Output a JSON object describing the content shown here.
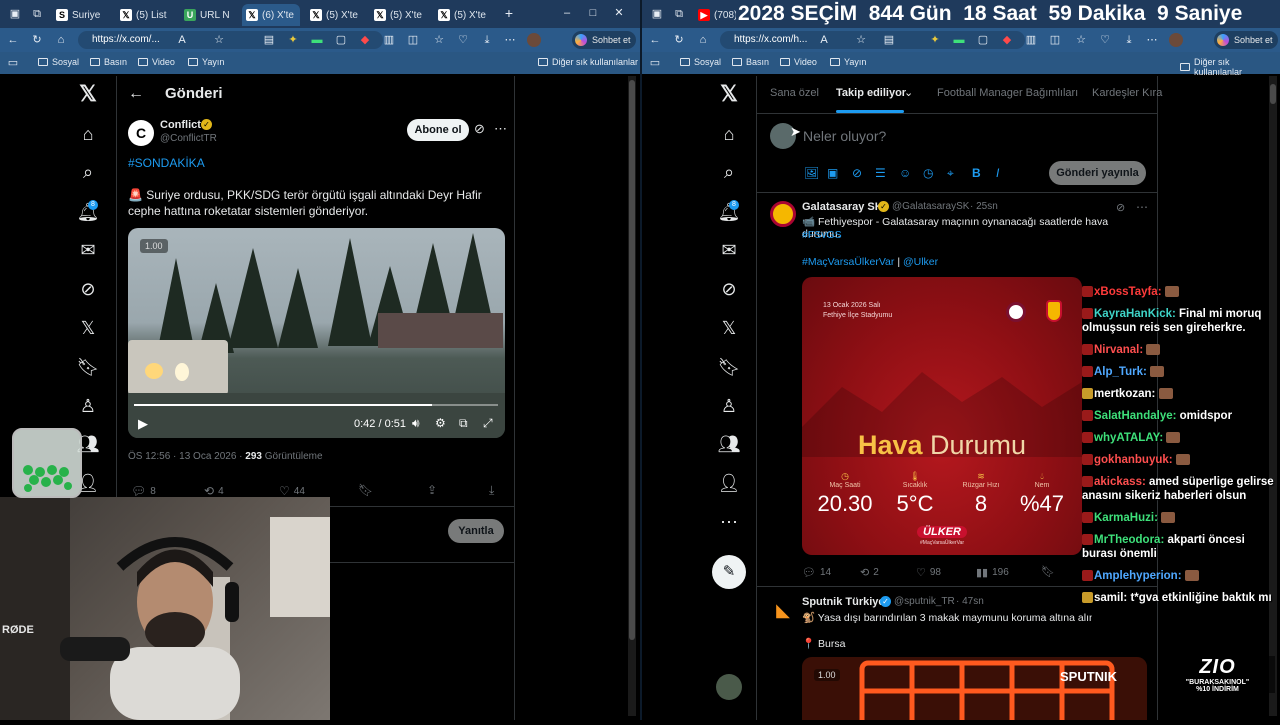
{
  "left_browser": {
    "tabs": [
      {
        "title": "Suriye",
        "icon": "S"
      },
      {
        "title": "(5) List",
        "icon": "X"
      },
      {
        "title": "URL N",
        "icon": "U"
      },
      {
        "title": "(6) X'te",
        "icon": "X"
      },
      {
        "title": "(5) X'te",
        "icon": "X"
      },
      {
        "title": "(5) X'te",
        "icon": "X"
      },
      {
        "title": "(5) X'te",
        "icon": "X"
      }
    ],
    "url": "https://x.com/...",
    "copilot_label": "Sohbet et",
    "bookmarks": [
      "Sosyal",
      "Basın",
      "Video",
      "Yayın"
    ],
    "other_bookmarks": "Diğer sık kullanılanlar"
  },
  "right_browser": {
    "tab_count": "(708)",
    "countdown": "2028 SEÇİM  844 Gün  18 Saat  59 Dakika  9 Saniye",
    "url": "https://x.com/h...",
    "copilot_label": "Sohbet et",
    "bookmarks": [
      "Sosyal",
      "Basın",
      "Video",
      "Yayın"
    ],
    "other_bookmarks": "Diğer sık kullanılanlar"
  },
  "post_page": {
    "header": "Gönderi",
    "author_name": "Conflict",
    "author_handle": "@ConflictTR",
    "follow_label": "Abone ol",
    "hashtag": "#SONDAKİKA",
    "text": "🚨 Suriye ordusu, PKK/SDG terör örgütü işgali altındaki Deyr Hafir cephe hattına roketatar sistemleri gönderiyor.",
    "video_speed": "1.00",
    "video_time": "0:42 / 0:51",
    "video_progress": 0.82,
    "meta_time": "ÖS 12:56 · 13 Oca 2026 ·",
    "views_count": "293",
    "views_label": "Görüntüleme",
    "replies": "8",
    "reposts": "4",
    "likes": "44",
    "reply_button": "Yanıtla",
    "notif_badge": "8"
  },
  "home": {
    "tabs": [
      "Sana özel",
      "Takip ediliyor",
      "Football Manager Bağımlıları",
      "Kardeşler Kıra"
    ],
    "compose_placeholder": "Neler oluyor?",
    "post_button": "Gönderi yayınla",
    "notif_badge": "8",
    "tweet1": {
      "name": "Galatasaray SK",
      "handle": "@GalatasaraySK",
      "time": "· 25sn",
      "line1": "📹 Fethiyespor - Galatasaray maçının oynanacağı saatlerde hava durumu.",
      "tag1": "#FSvGS",
      "tag2": "#MaçVarsaÜlkerVar",
      "sep": "|",
      "mention": "@Ulker",
      "card_date": "13 Ocak 2026 Salı",
      "card_venue": "Fethiye İlçe Stadyumu",
      "card_title_a": "Hava",
      "card_title_b": "Durumu",
      "stats": [
        {
          "label": "Maç Saati",
          "value": "20.30"
        },
        {
          "label": "Sıcaklık",
          "value": "5°C"
        },
        {
          "label": "Rüzgar Hızı",
          "value": "8"
        },
        {
          "label": "Nem",
          "value": "%47"
        }
      ],
      "sponsor": "ÜLKER",
      "sponsor_tag": "#MaçVarsaÜlkerVar",
      "replies": "14",
      "reposts": "2",
      "likes": "98",
      "views": "196"
    },
    "tweet2": {
      "name": "Sputnik Türkiye",
      "handle": "@sputnik_TR",
      "time": "· 47sn",
      "line1": "🐒 Yasa dışı barındırılan 3 makak maymunu koruma altına alındı",
      "location": "📍 Bursa",
      "badge": "SPUTNIK",
      "speed": "1.00"
    }
  },
  "chat": [
    {
      "user": "xBossTayfa:",
      "msg": "",
      "color": "#ff3b3b"
    },
    {
      "user": "KayraHanKick:",
      "msg": "Final mi moruq olmuşsun reis sen gireherkre.",
      "color": "#3fd4c8"
    },
    {
      "user": "Nirvanal:",
      "msg": "",
      "color": "#ff4f4f"
    },
    {
      "user": "Alp_Turk:",
      "msg": "",
      "color": "#4fa8ff"
    },
    {
      "user": "mertkozan:",
      "msg": "",
      "color": "#ffffff"
    },
    {
      "user": "SalatHandalye:",
      "msg": "omidspor",
      "color": "#3ee07a"
    },
    {
      "user": "whyATALAY:",
      "msg": "",
      "color": "#3ee07a"
    },
    {
      "user": "gokhanbuyuk:",
      "msg": "",
      "color": "#ff4f4f"
    },
    {
      "user": "akickass:",
      "msg": "amed süperlige gelirse anasını sikeriz haberleri olsun",
      "color": "#ff4f4f"
    },
    {
      "user": "KarmaHuzi:",
      "msg": "",
      "color": "#3ee07a"
    },
    {
      "user": "MrTheodora:",
      "msg": "akparti öncesi burası önemli",
      "color": "#3ee07a"
    },
    {
      "user": "Amplehyperion:",
      "msg": "",
      "color": "#4fa8ff"
    },
    {
      "user": "samil:",
      "msg": "t*gva etkinliğine baktık mı",
      "color": "#ffffff"
    }
  ],
  "sponsor_overlay": {
    "logo": "ZIO",
    "line1": "\"BURAKSAKINOL\"",
    "line2": "%10 İNDİRİM"
  },
  "mic_brand": "RØDE"
}
